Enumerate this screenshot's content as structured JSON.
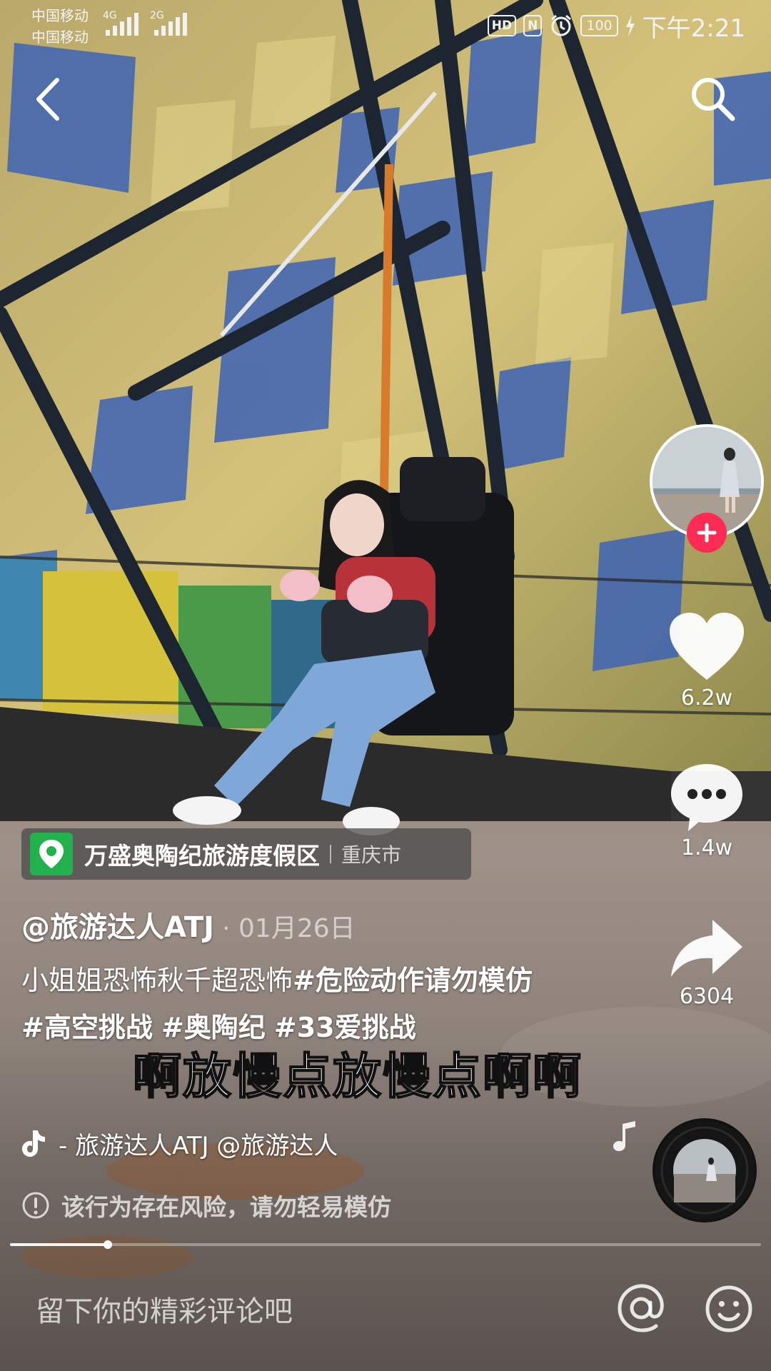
{
  "status_bar": {
    "carrier_1": "中国移动",
    "carrier_2": "中国移动",
    "signal_1_label": "4G",
    "signal_2_label": "2G",
    "hd_badge": "HD",
    "nfc_badge": "N",
    "battery": "100",
    "time": "下午2:21"
  },
  "icons": {
    "back": "back-chevron-icon",
    "search": "search-icon",
    "like": "heart-icon",
    "comment": "comment-bubble-icon",
    "share": "share-arrow-icon",
    "location": "location-pin-icon",
    "tiktok": "tiktok-note-icon",
    "warning": "exclamation-circle-icon",
    "at": "at-icon",
    "emoji": "smiley-icon"
  },
  "rail": {
    "likes": "6.2w",
    "comments": "1.4w",
    "shares": "6304"
  },
  "location": {
    "name": "万盛奥陶纪旅游度假区",
    "city": "重庆市"
  },
  "post": {
    "author": "@旅游达人ATJ",
    "date": "· 01月26日",
    "caption_text": "小姐姐恐怖秋千超恐怖",
    "hashtag_1": "#危险动作请勿模仿",
    "hashtag_2": "#高空挑战",
    "hashtag_3": "#奥陶纪",
    "hashtag_4": "#33爱挑战"
  },
  "subtitle": "啊放慢点放慢点啊啊",
  "music": {
    "text": "- 旅游达人ATJ   @旅游达人"
  },
  "warning": "该行为存在风险，请勿轻易模仿",
  "progress": {
    "fraction": 0.13
  },
  "comment_bar": {
    "placeholder": "留下你的精彩评论吧"
  },
  "colors": {
    "follow_plus": "#fe2c55",
    "location_icon_bg": "#22b14c"
  }
}
